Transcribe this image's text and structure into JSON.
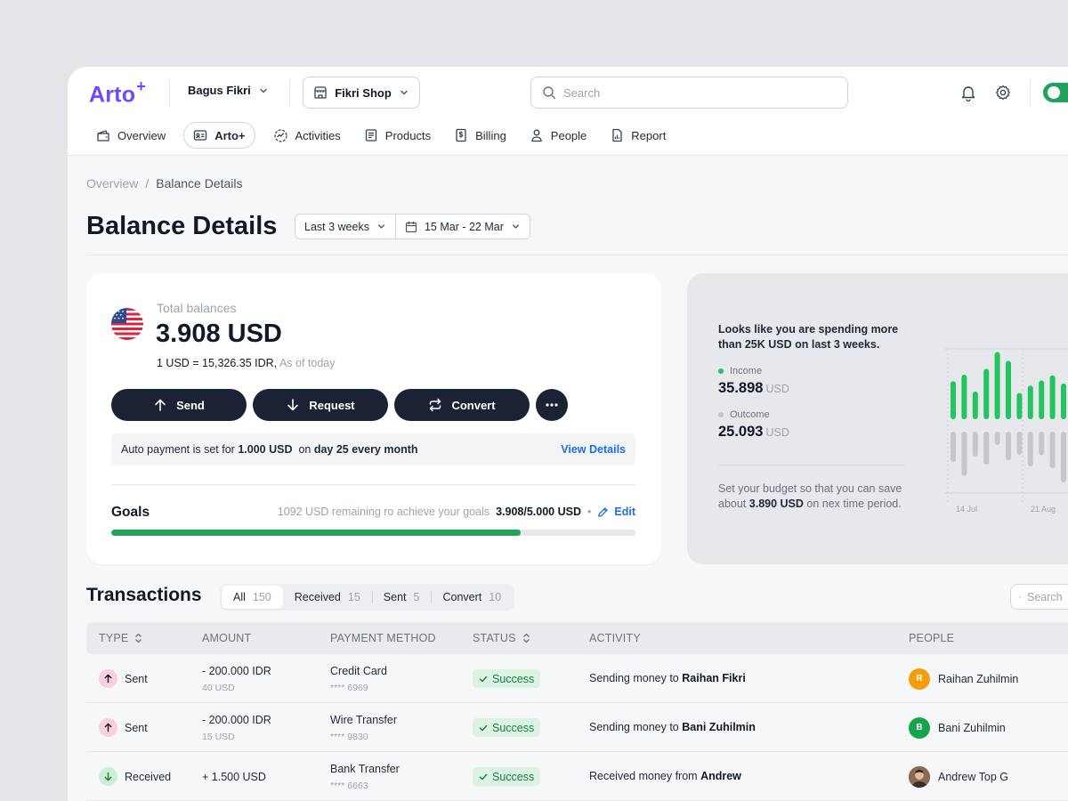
{
  "app": {
    "logo": "Arto",
    "logo_sup": "+",
    "account_name": "Bagus Fikri",
    "shop_name": "Fikri Shop",
    "search_placeholder": "Search",
    "theme_toggle_on": true
  },
  "nav": [
    {
      "label": "Overview",
      "icon": "wallet-icon",
      "active": false
    },
    {
      "label": "Arto+",
      "icon": "id-card-icon",
      "active": true
    },
    {
      "label": "Activities",
      "icon": "activity-icon",
      "active": false
    },
    {
      "label": "Products",
      "icon": "products-icon",
      "active": false
    },
    {
      "label": "Billing",
      "icon": "billing-icon",
      "active": false
    },
    {
      "label": "People",
      "icon": "person-icon",
      "active": false
    },
    {
      "label": "Report",
      "icon": "report-icon",
      "active": false
    }
  ],
  "breadcrumb": {
    "root": "Overview",
    "separator": "/",
    "current": "Balance Details"
  },
  "page": {
    "title": "Balance Details",
    "range_select": "Last 3 weeks",
    "date_range": "15 Mar - 22 Mar"
  },
  "balance": {
    "label": "Total balances",
    "amount": "3.908 USD",
    "rate": "1 USD = 15,326.35 IDR,",
    "rate_note": "As of today",
    "actions": {
      "send": "Send",
      "request": "Request",
      "convert": "Convert"
    },
    "auto_pay": {
      "prefix": "Auto payment is set for",
      "amount": "1.000 USD",
      "middle": "on",
      "schedule": "day 25 every month",
      "link": "View Details"
    },
    "goals": {
      "title": "Goals",
      "remaining": "1092 USD remaining ro achieve your goals",
      "progress_text": "3.908/5.000 USD",
      "edit": "Edit",
      "progress_fraction": 0.7816
    }
  },
  "insight": {
    "headline": "Looks like you are spending more than 25K USD on last 3 weeks.",
    "income_label": "Income",
    "income_value": "35.898",
    "outcome_label": "Outcome",
    "outcome_value": "25.093",
    "unit": "USD",
    "note_prefix": "Set your budget so that you can save about",
    "note_amount": "3.890 USD",
    "note_suffix": "on nex time period.",
    "colors": {
      "income": "#22c55e",
      "outcome": "#c4c7cc"
    },
    "chart": {
      "x_ticks": [
        "14 Jul",
        "21 Aug"
      ],
      "income_bars": [
        0.52,
        0.61,
        0.38,
        0.69,
        0.92,
        0.8,
        0.36,
        0.46,
        0.53,
        0.6,
        0.49,
        0.63
      ],
      "outcome_bars": [
        0.55,
        0.8,
        0.45,
        0.6,
        0.24,
        0.52,
        0.42,
        0.63,
        0.43,
        0.66,
        0.92,
        0.5
      ]
    }
  },
  "transactions": {
    "title": "Transactions",
    "tabs": [
      {
        "label": "All",
        "count": "150",
        "active": true
      },
      {
        "label": "Received",
        "count": "15",
        "active": false
      },
      {
        "label": "Sent",
        "count": "5",
        "active": false
      },
      {
        "label": "Convert",
        "count": "10",
        "active": false
      }
    ],
    "search_placeholder": "Search",
    "columns": [
      "TYPE",
      "AMOUNT",
      "PAYMENT METHOD",
      "STATUS",
      "ACTIVITY",
      "PEOPLE"
    ],
    "rows": [
      {
        "type": "Sent",
        "direction": "up",
        "amount": "- 200.000 IDR",
        "amount_sub": "40 USD",
        "method": "Credit Card",
        "method_sub": "**** 6969",
        "status": "Success",
        "activity_prefix": "Sending money to",
        "activity_name": "Raihan Fikri",
        "person": "Raihan Zuhilmin",
        "avatar": "R",
        "avatar_color": "#f59e0b"
      },
      {
        "type": "Sent",
        "direction": "up",
        "amount": "- 200.000 IDR",
        "amount_sub": "15 USD",
        "method": "Wire Transfer",
        "method_sub": "**** 9830",
        "status": "Success",
        "activity_prefix": "Sending money to",
        "activity_name": "Bani Zuhilmin",
        "person": "Bani Zuhilmin",
        "avatar": "B",
        "avatar_color": "#16a34a"
      },
      {
        "type": "Received",
        "direction": "down",
        "amount": "+ 1.500 USD",
        "amount_sub": "",
        "method": "Bank Transfer",
        "method_sub": "**** 6663",
        "status": "Success",
        "activity_prefix": "Received money from",
        "activity_name": "Andrew",
        "person": "Andrew Top G",
        "avatar": "",
        "avatar_color": "#6b4f3f"
      }
    ]
  }
}
